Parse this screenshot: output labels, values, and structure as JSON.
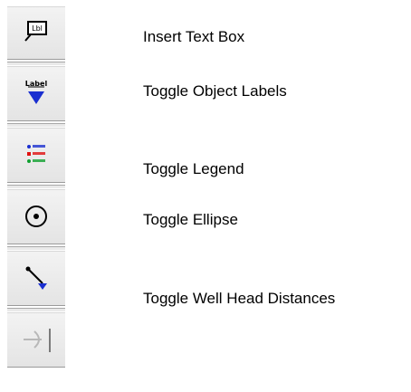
{
  "toolbar": {
    "items": [
      {
        "label": "Insert Text Box",
        "icon": "text-box-icon"
      },
      {
        "label": "Toggle Object Labels",
        "icon": "object-labels-icon"
      },
      {
        "label": "Toggle Legend",
        "icon": "legend-icon"
      },
      {
        "label": "Toggle Ellipse",
        "icon": "ellipse-icon"
      },
      {
        "label": "Toggle Well Head Distances",
        "icon": "well-head-distance-icon"
      },
      {
        "label": "",
        "icon": "arrow-right-icon"
      }
    ]
  },
  "colors": {
    "button_bg": "#ececec",
    "label_blue": "#1a2fd0",
    "legend_red": "#e01010",
    "legend_green": "#10a030"
  }
}
